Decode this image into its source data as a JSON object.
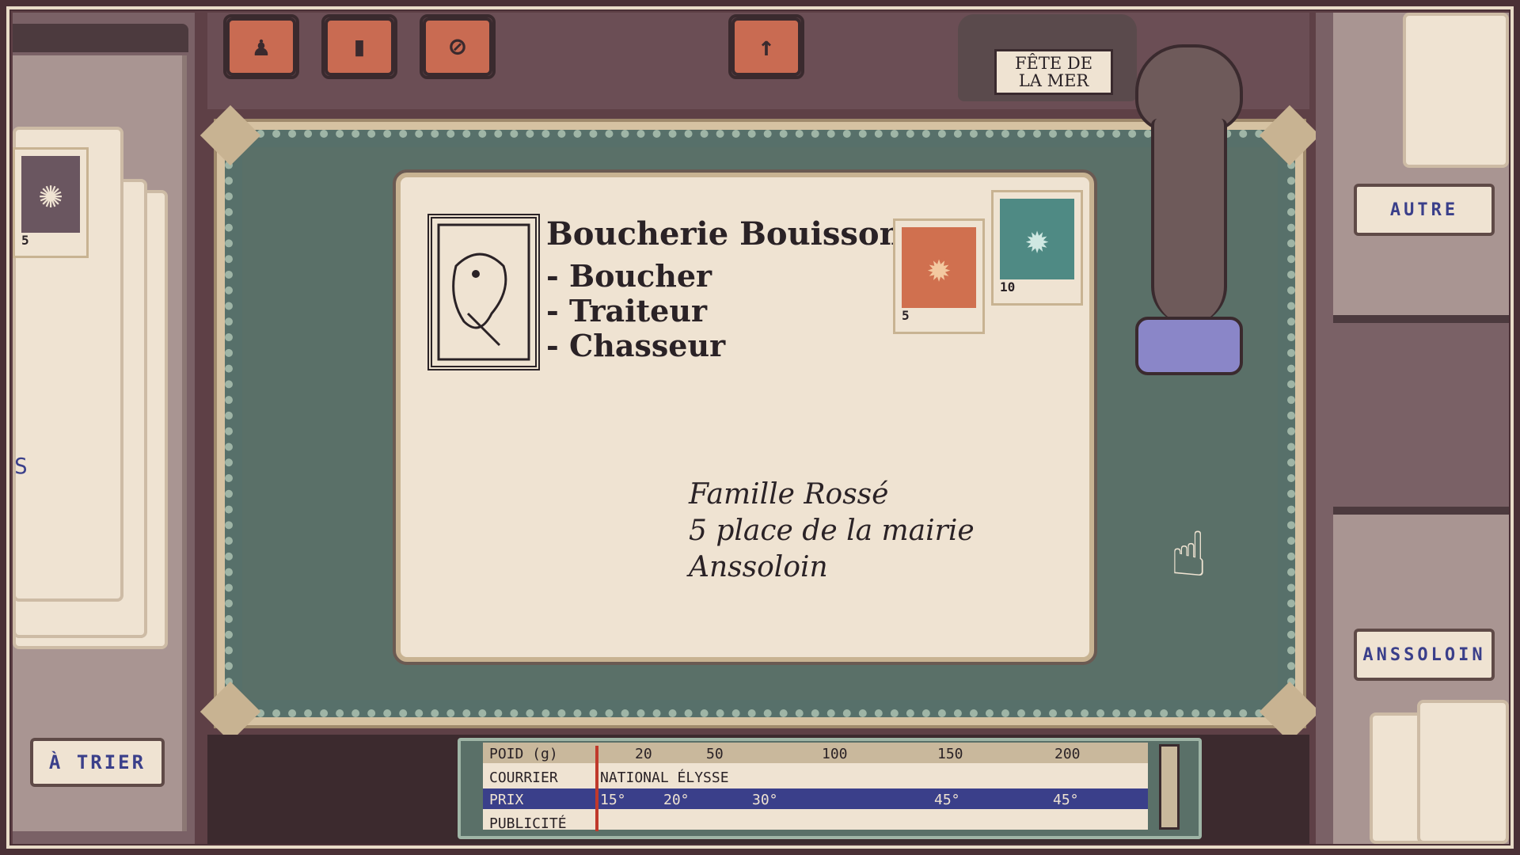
{
  "left": {
    "sort_button": "À TRIER",
    "card_stamp_value": "5",
    "card_text": "S"
  },
  "toolbar": {
    "buttons": [
      {
        "name": "stamp-tool",
        "icon": "person-stamp-icon",
        "glyph": "♟"
      },
      {
        "name": "book-tool",
        "icon": "book-icon",
        "glyph": "▮"
      },
      {
        "name": "clip-tool",
        "icon": "paperclip-icon",
        "glyph": "⊘"
      }
    ],
    "send_icon": "up-arrow-icon",
    "send_glyph": "↑"
  },
  "stamp_holder": {
    "label_line1": "FÊTE DE",
    "label_line2": "LA MER"
  },
  "envelope": {
    "sender_name": "Boucherie Bouisson",
    "sender_services": [
      "- Boucher",
      "- Traiteur",
      "- Chasseur"
    ],
    "stamps": [
      {
        "value": "5",
        "color": "#d0704f",
        "icon": "sun-icon"
      },
      {
        "value": "10",
        "color": "#4f8a84",
        "icon": "sun-icon"
      }
    ],
    "recipient_lines": [
      "Famille Rossé",
      "5 place de la mairie",
      "Anssoloin"
    ]
  },
  "right": {
    "top_button": "AUTRE",
    "bottom_button": "ANSSOLOIN"
  },
  "rate_table": {
    "weight_label": "POID (g)",
    "weights": [
      "20",
      "50",
      "100",
      "150",
      "200"
    ],
    "courrier_label": "COURRIER",
    "courrier_value": "NATIONAL ÉLYSSE",
    "price_label": "PRIX",
    "prices": [
      "15°",
      "20°",
      "30°",
      "45°",
      "45°"
    ],
    "last_label": "PUBLICITÉ"
  },
  "colors": {
    "accent": "#3a3f8a",
    "mat": "#5a7068",
    "paper": "#efe3d2",
    "tool": "#c96b52"
  }
}
